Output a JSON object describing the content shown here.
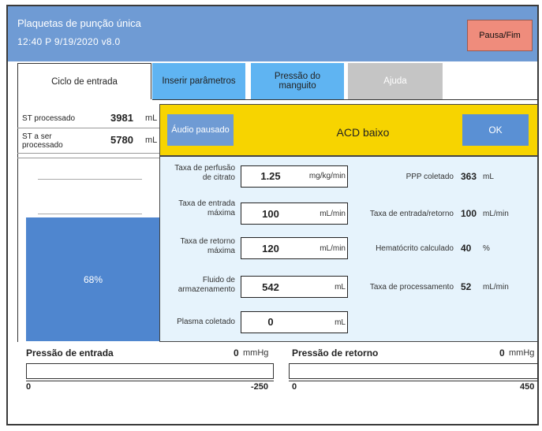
{
  "header": {
    "title": "Plaquetas de punção única",
    "status": "12:40 P  9/19/2020   v8.0",
    "pause_button": "Pausa/Fim"
  },
  "tabs": [
    {
      "label": "Ciclo de entrada"
    },
    {
      "label": "Inserir parâmetros"
    },
    {
      "label": "Pressão do manguito"
    },
    {
      "label": "Ajuda"
    }
  ],
  "left": {
    "st_processed_label": "ST processado",
    "st_processed_value": "3981",
    "st_processed_unit": "mL",
    "st_remaining_label": "ST a ser processado",
    "st_remaining_value": "5780",
    "st_remaining_unit": "mL",
    "progress_text": "68%",
    "progress_fraction": 0.68
  },
  "alert": {
    "audio_button": "Áudio pausado",
    "message": "ACD baixo",
    "ok_button": "OK"
  },
  "params": [
    {
      "label": "Taxa de perfusão de citrato",
      "value": "1.25",
      "unit": "mg/kg/min"
    },
    {
      "label": "Taxa de entrada máxima",
      "value": "100",
      "unit": "mL/min"
    },
    {
      "label": "Taxa de retorno máxima",
      "value": "120",
      "unit": "mL/min"
    },
    {
      "label": "Fluido de armazenamento",
      "value": "542",
      "unit": "mL"
    },
    {
      "label": "Plasma coletado",
      "value": "0",
      "unit": "mL"
    }
  ],
  "readouts": [
    {
      "label": "PPP coletado",
      "value": "363",
      "unit": "mL"
    },
    {
      "label": "Taxa de entrada/retorno",
      "value": "100",
      "unit": "mL/min"
    },
    {
      "label": "Hematócrito calculado",
      "value": "40",
      "unit": "%"
    },
    {
      "label": "Taxa de processamento",
      "value": "52",
      "unit": "mL/min"
    }
  ],
  "pressure": {
    "inlet_label": "Pressão de entrada",
    "inlet_value": "0",
    "inlet_unit": "mmHg",
    "inlet_min": "0",
    "inlet_max": "-250",
    "return_label": "Pressão de retorno",
    "return_value": "0",
    "return_unit": "mmHg",
    "return_min": "0",
    "return_max": "450"
  },
  "colors": {
    "header_bg": "#6f9bd4",
    "pause_btn": "#ef8c7c",
    "tab_blue": "#5fb4f2",
    "alert_yellow": "#f7d400",
    "params_bg": "#e6f3fc"
  }
}
